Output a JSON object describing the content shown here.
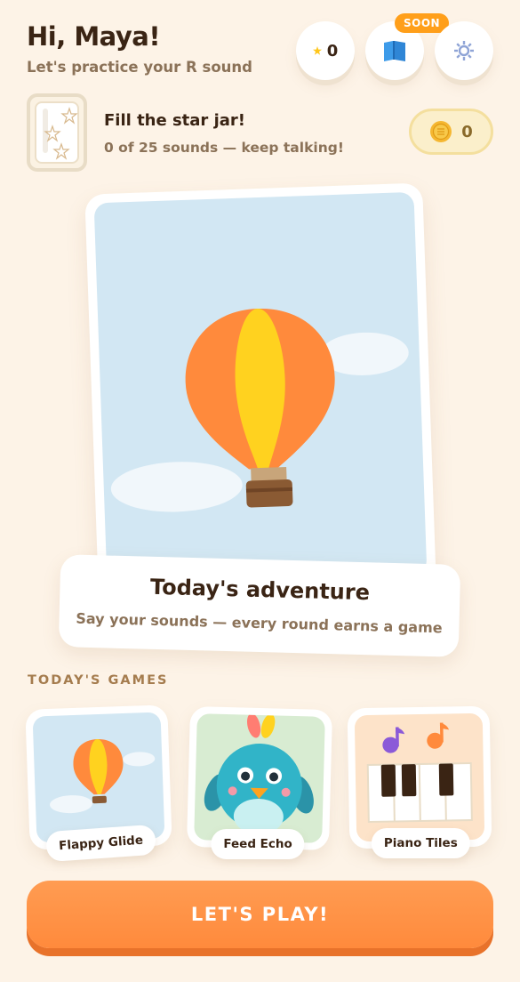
{
  "header": {
    "greeting": "Hi, Maya!",
    "subtitle": "Let's practice your R sound",
    "star_count": "0",
    "soon_badge": "SOON"
  },
  "jar": {
    "title": "Fill the star jar!",
    "subtitle": "0 of 25 sounds — keep talking!",
    "coin_count": "0"
  },
  "hero": {
    "title": "Today's adventure",
    "subtitle": "Say your sounds — every round earns a game"
  },
  "games": {
    "section_label": "TODAY'S GAMES",
    "items": [
      {
        "label": "Flappy Glide"
      },
      {
        "label": "Feed Echo"
      },
      {
        "label": "Piano Tiles"
      }
    ]
  },
  "play_button": {
    "label": "LET'S PLAY!"
  },
  "colors": {
    "background": "#fdf3e7",
    "accent_orange": "#ff8a3c",
    "sky": "#d2e7f3",
    "balloon_orange": "#ff8a3c",
    "balloon_yellow": "#ffd21f",
    "coin_gold": "#f5b731"
  },
  "icons": [
    "star-icon",
    "map-book-icon",
    "gear-icon",
    "coin-icon",
    "balloon-icon",
    "bird-icon",
    "music-note-icon"
  ]
}
